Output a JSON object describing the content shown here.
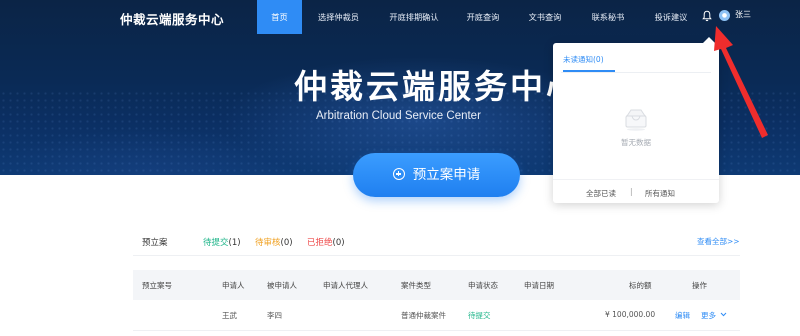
{
  "header": {
    "brand": "仲裁云端服务中心",
    "nav": [
      {
        "label": "首页",
        "active": true
      },
      {
        "label": "选择仲裁员",
        "active": false
      },
      {
        "label": "开庭排期确认",
        "active": false
      },
      {
        "label": "开庭查询",
        "active": false
      },
      {
        "label": "文书查询",
        "active": false
      },
      {
        "label": "联系秘书",
        "active": false
      },
      {
        "label": "投诉建议",
        "active": false
      }
    ],
    "bell_icon": "bell-icon",
    "user_name": "张三",
    "accent_color": "#2f8cf5"
  },
  "hero": {
    "title": "仲裁云端服务中心",
    "subtitle": "Arbitration Cloud Service Center",
    "cta_label": "预立案申请",
    "cta_icon": "plus-circle-icon"
  },
  "notifications": {
    "tab_label": "未读通知(0)",
    "empty_text": "暂无数据",
    "mark_all_read": "全部已读",
    "separator": "|",
    "all_notifications": "所有通知"
  },
  "cases": {
    "section_title": "预立案",
    "tabs": [
      {
        "label": "待提交",
        "count": "(1)",
        "color": "#1fb58a"
      },
      {
        "label": "待审核",
        "count": "(0)",
        "color": "#f0a020"
      },
      {
        "label": "已拒绝",
        "count": "(0)",
        "color": "#ee4b4b"
      }
    ],
    "view_all": "查看全部>>",
    "columns": [
      "预立案号",
      "申请人",
      "被申请人",
      "申请人代理人",
      "案件类型",
      "申请状态",
      "申请日期",
      "标的额",
      "操作"
    ],
    "rows": [
      {
        "case_no": "",
        "applicant": "王武",
        "respondent": "李四",
        "agent": "",
        "case_type": "普通仲裁案件",
        "status": "待提交",
        "date": "",
        "amount": "¥ 100,000.00",
        "action_edit": "编辑",
        "action_more": "更多"
      }
    ]
  }
}
